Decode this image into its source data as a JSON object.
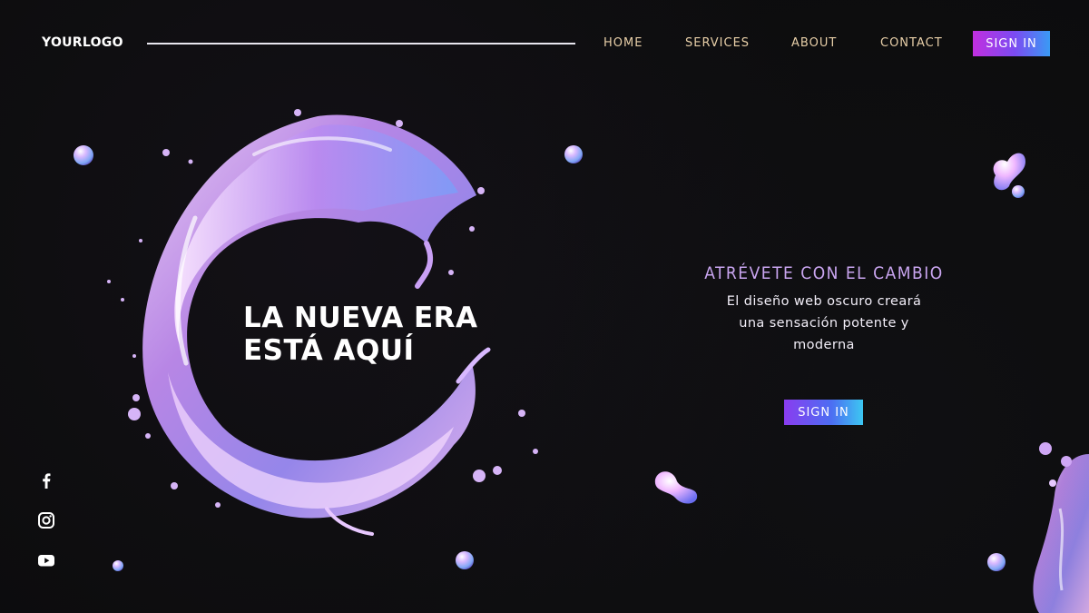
{
  "header": {
    "logo": "YOURLOGO",
    "nav": [
      "HOME",
      "SERVICES",
      "ABOUT",
      "CONTACT"
    ],
    "signin_label": "SIGN IN"
  },
  "hero": {
    "title_line1": "LA NUEVA ERA",
    "title_line2": "ESTÁ AQUÍ"
  },
  "aside": {
    "tagline": "ATRÉVETE CON EL CAMBIO",
    "description_lines": [
      "El diseño web oscuro creará",
      "una sensación potente y",
      "moderna"
    ],
    "signin_label": "SIGN IN"
  },
  "social": {
    "icons": [
      "facebook-icon",
      "instagram-icon",
      "youtube-icon"
    ]
  },
  "colors": {
    "background": "#0c0c0d",
    "nav_text": "#e8cfa8",
    "tagline": "#c9a5f0",
    "button_gradient_start": "#c12fe0",
    "button_gradient_end": "#3a9af4"
  }
}
